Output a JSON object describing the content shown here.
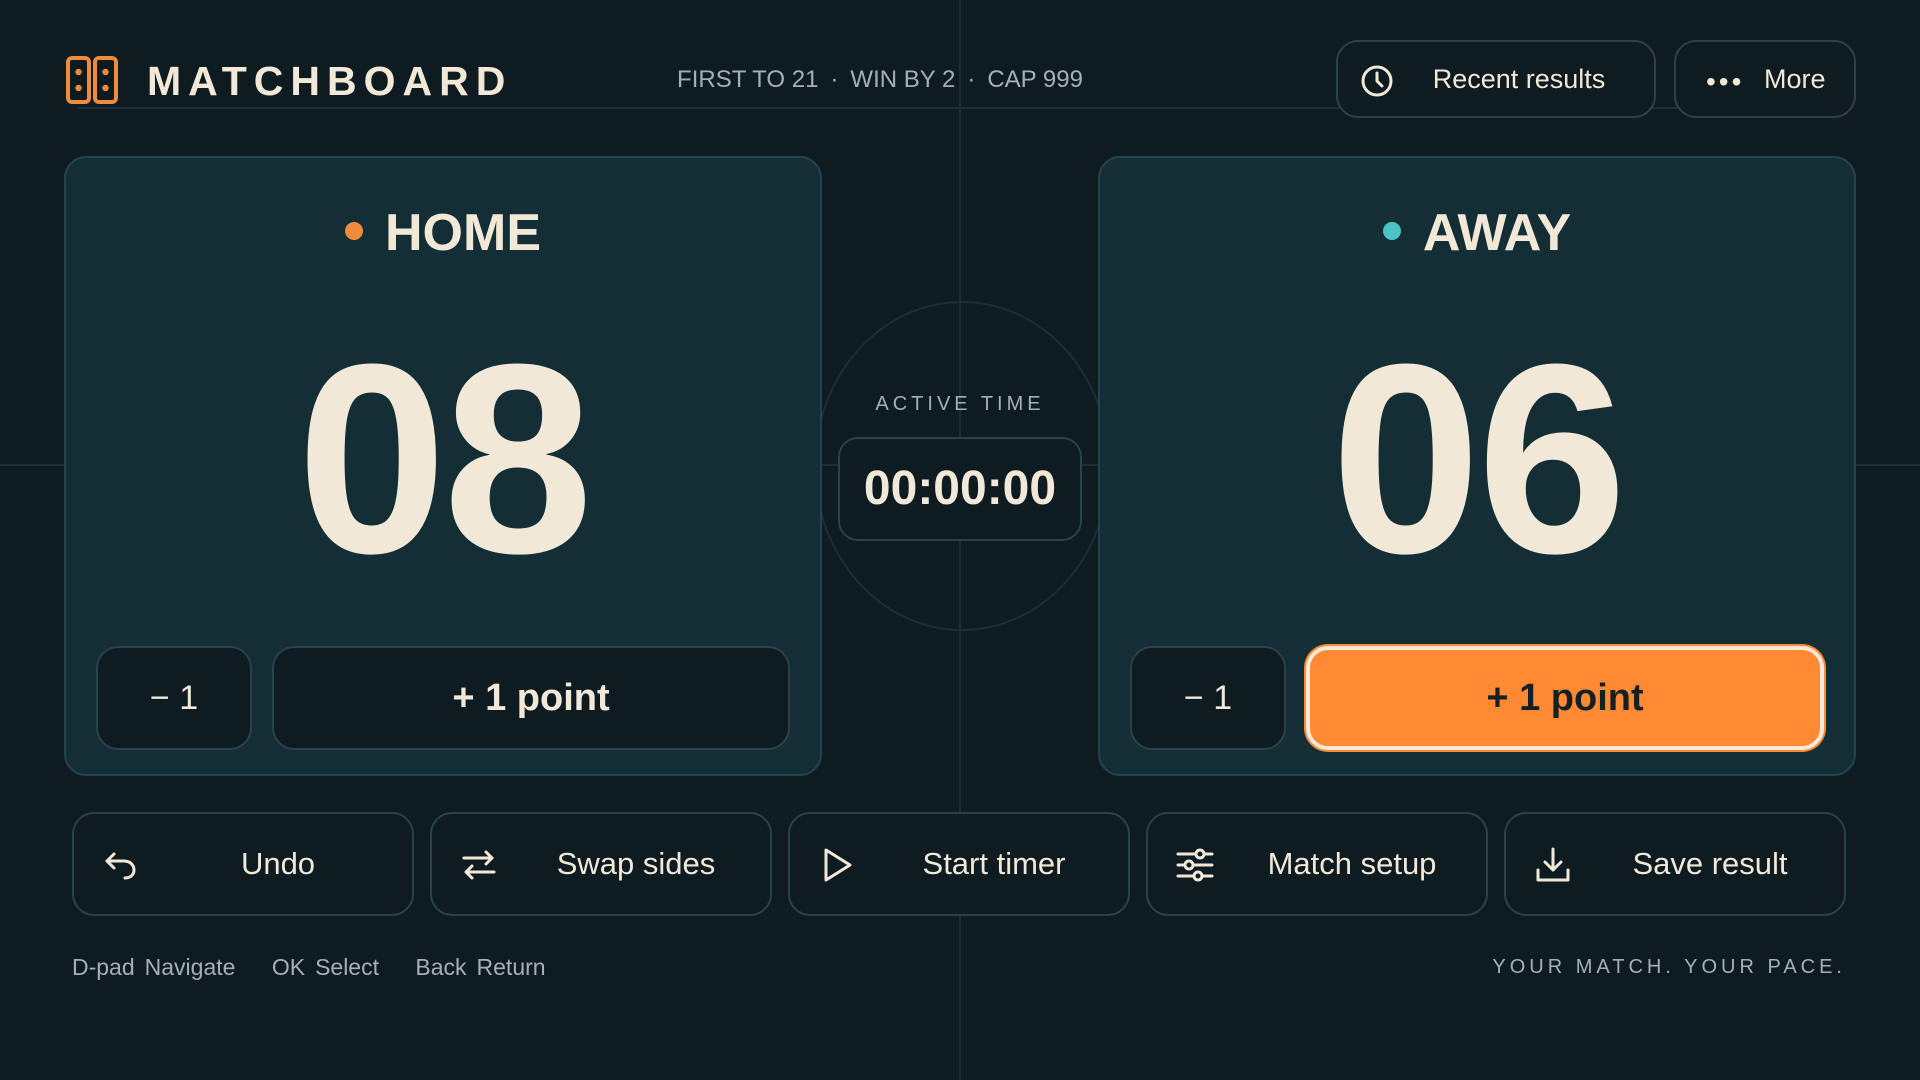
{
  "brand": {
    "name": "MATCHBOARD",
    "icon": "scoreboard-icon",
    "accent": "#f08a3c"
  },
  "rules": {
    "first_to": "FIRST TO 21",
    "win_by": "WIN BY 2",
    "cap": "CAP 999",
    "separator": "·"
  },
  "header": {
    "recent_results": {
      "label": "Recent results",
      "icon": "clock-icon"
    },
    "more": {
      "label": "More",
      "icon": "ellipsis-icon"
    }
  },
  "home": {
    "name": "HOME",
    "score": "08",
    "color": "#f08a3c",
    "minus_label": "− 1",
    "plus_label": "+ 1 point"
  },
  "away": {
    "name": "AWAY",
    "score": "06",
    "color": "#4cc4c8",
    "minus_label": "− 1",
    "plus_label": "+ 1 point",
    "focused": "plus"
  },
  "timer": {
    "label": "ACTIVE TIME",
    "value": "00:00:00"
  },
  "actions": [
    {
      "label": "Undo",
      "icon": "undo-icon"
    },
    {
      "label": "Swap sides",
      "icon": "swap-icon"
    },
    {
      "label": "Start timer",
      "icon": "play-icon"
    },
    {
      "label": "Match setup",
      "icon": "sliders-icon"
    },
    {
      "label": "Save result",
      "icon": "download-icon"
    }
  ],
  "hints": [
    {
      "key": "D-pad",
      "action": "Navigate"
    },
    {
      "key": "OK",
      "action": "Select"
    },
    {
      "key": "Back",
      "action": "Return"
    }
  ],
  "tagline": "YOUR MATCH. YOUR PACE.",
  "colors": {
    "background": "#0e1b20",
    "panel": "#142e36",
    "text": "#f2e8d8",
    "focus": "#ff8a33"
  }
}
